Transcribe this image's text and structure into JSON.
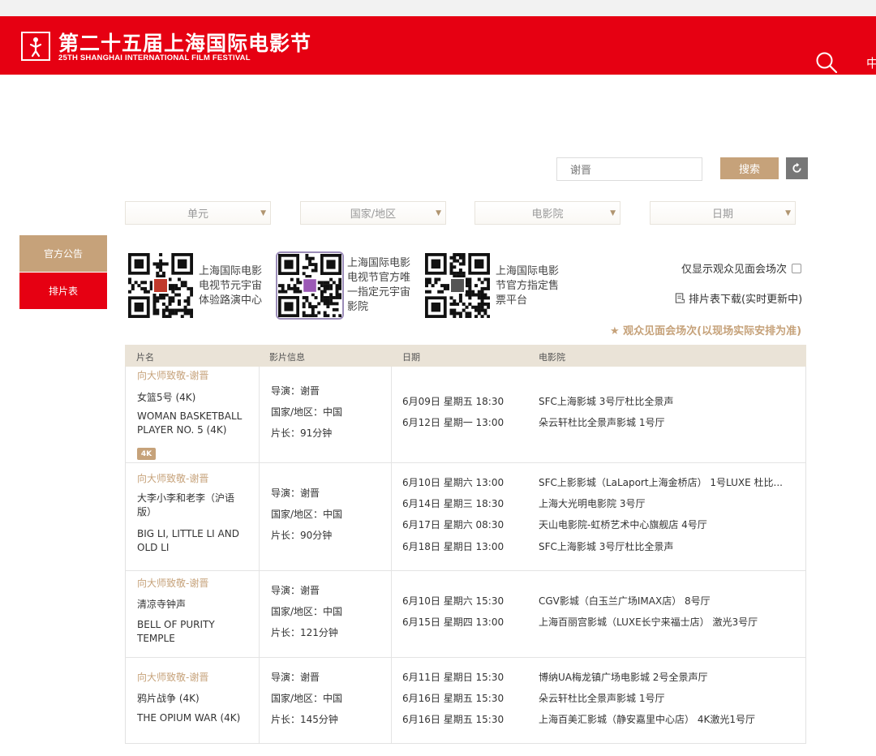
{
  "header": {
    "brand_cn": "第二十五届上海国际电影节",
    "brand_en": "25TH SHANGHAI INTERNATIONAL FILM FESTIVAL",
    "lang": "中",
    "color": "#e60012"
  },
  "search": {
    "value": "谢晋",
    "button": "搜索"
  },
  "filters": [
    "单元",
    "国家/地区",
    "电影院",
    "日期"
  ],
  "sidebar": {
    "notice": "官方公告",
    "schedule": "排片表"
  },
  "qrcodes": [
    {
      "lines": [
        "上海国际电影",
        "电视节元宇宙",
        "体验路演中心"
      ]
    },
    {
      "lines": [
        "上海国际电影",
        "电视节官方唯",
        "一指定元宇宙",
        "影院"
      ]
    },
    {
      "lines": [
        "上海国际电影",
        "节官方指定售",
        "票平台"
      ]
    }
  ],
  "options": {
    "meet_only": "仅显示观众见面会场次",
    "download": "排片表下载(实时更新中)",
    "meet_note": "★ 观众见面会场次(以现场实际安排为准)"
  },
  "table": {
    "headers": [
      "片名",
      "影片信息",
      "日期",
      "电影院"
    ],
    "rows": [
      {
        "section": "向大师致敬-谢晋",
        "title_cn": "女篮5号 (4K)",
        "title_en": [
          "WOMAN BASKETBALL",
          "PLAYER NO. 5 (4K)"
        ],
        "badge": "4K",
        "director": "导演：谢晋",
        "country": "国家/地区：中国",
        "length": "片长：91分钟",
        "screenings": [
          {
            "date": "6月09日 星期五 18:30",
            "cinema": "SFC上海影城 3号厅杜比全景声"
          },
          {
            "date": "6月12日 星期一 13:00",
            "cinema": "朵云轩杜比全景声影城 1号厅"
          }
        ]
      },
      {
        "section": "向大师致敬-谢晋",
        "title_cn": [
          "大李小李和老李（沪语",
          "版）"
        ],
        "title_en": [
          "BIG LI, LITTLE LI AND",
          "OLD LI"
        ],
        "director": "导演：谢晋",
        "country": "国家/地区：中国",
        "length": "片长：90分钟",
        "screenings": [
          {
            "date": "6月10日 星期六 13:00",
            "cinema": "SFC上影影城（LaLaport上海金桥店） 1号LUXE 杜比..."
          },
          {
            "date": "6月14日 星期三 18:30",
            "cinema": "上海大光明电影院 3号厅"
          },
          {
            "date": "6月17日 星期六 08:30",
            "cinema": "天山电影院-虹桥艺术中心旗舰店 4号厅"
          },
          {
            "date": "6月18日 星期日 13:00",
            "cinema": "SFC上海影城 3号厅杜比全景声"
          }
        ]
      },
      {
        "section": "向大师致敬-谢晋",
        "title_cn": "清凉寺钟声",
        "title_en": [
          "BELL OF PURITY",
          "TEMPLE"
        ],
        "director": "导演：谢晋",
        "country": "国家/地区：中国",
        "length": "片长：121分钟",
        "screenings": [
          {
            "date": "6月10日 星期六 15:30",
            "cinema": "CGV影城（白玉兰广场IMAX店） 8号厅"
          },
          {
            "date": "6月15日 星期四 13:00",
            "cinema": "上海百丽宫影城（LUXE长宁来福士店） 激光3号厅"
          }
        ]
      },
      {
        "section": "向大师致敬-谢晋",
        "title_cn": "鸦片战争 (4K)",
        "title_en": [
          "THE OPIUM WAR (4K)"
        ],
        "director": "导演：谢晋",
        "country": "国家/地区：中国",
        "length": "片长：145分钟",
        "screenings": [
          {
            "date": "6月11日 星期日 15:30",
            "cinema": "博纳UA梅龙镇广场电影城 2号全景声厅"
          },
          {
            "date": "6月16日 星期五 15:30",
            "cinema": "朵云轩杜比全景声影城 1号厅"
          },
          {
            "date": "6月16日 星期五 15:30",
            "cinema": "上海百美汇影城（静安嘉里中心店） 4K激光1号厅"
          }
        ]
      }
    ]
  },
  "colors": {
    "accent_gold": "#c6a27a",
    "header_red": "#e60012",
    "table_header_bg": "#eae3d7"
  }
}
